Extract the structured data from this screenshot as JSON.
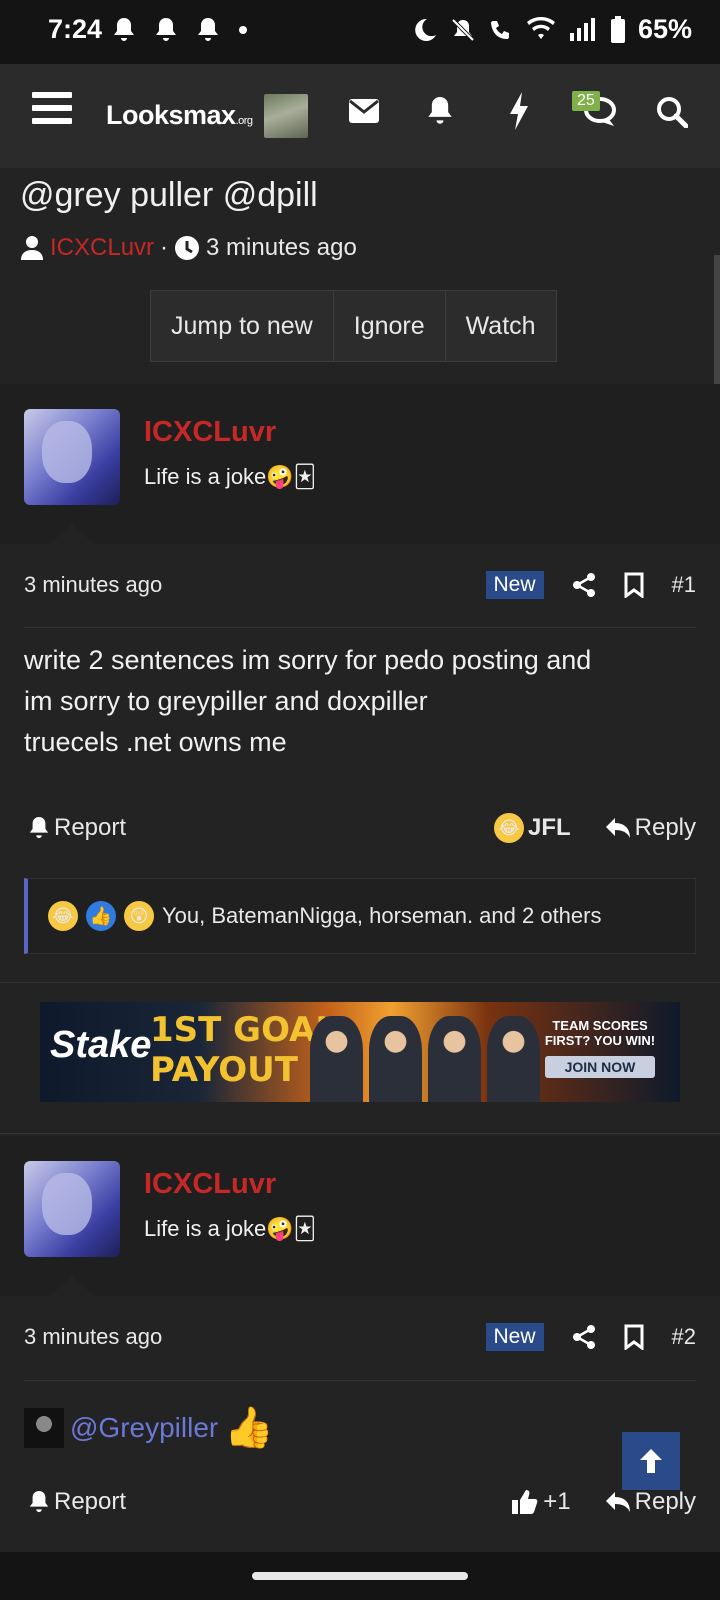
{
  "status_bar": {
    "time": "7:24",
    "battery": "65%",
    "icons": [
      "bell-icon",
      "bell-icon",
      "bell-icon",
      "dot-icon",
      "moon-icon",
      "bell-off-icon",
      "wifi-call-icon",
      "wifi-icon",
      "signal-icon",
      "battery-icon"
    ]
  },
  "navbar": {
    "logo_text": "Looksmax",
    "logo_suffix": ".org",
    "conversations_badge": "25",
    "icons": [
      "menu-icon",
      "mail-icon",
      "bell-icon",
      "lightning-icon",
      "chat-icon",
      "search-icon"
    ]
  },
  "thread": {
    "title": "@grey puller @dpill",
    "author": "ICXCLuvr",
    "separator": "·",
    "time": "3 minutes ago",
    "buttons": [
      "Jump to new",
      "Ignore",
      "Watch"
    ]
  },
  "posts": [
    {
      "username": "ICXCLuvr",
      "user_title": "Life is a joke🤪🃏",
      "time": "3 minutes ago",
      "new_label": "New",
      "number": "#1",
      "body_lines": [
        "write 2 sentences im sorry for pedo posting and",
        "im sorry to greypiller and doxpiller",
        "truecels .net owns me"
      ],
      "report_label": "Report",
      "reaction_label": "JFL",
      "reply_label": "Reply",
      "reactions_text": "You, BatemanNigga, horseman. and 2 others"
    },
    {
      "username": "ICXCLuvr",
      "user_title": "Life is a joke🤪🃏",
      "time": "3 minutes ago",
      "new_label": "New",
      "number": "#2",
      "mention": "@Greypiller",
      "report_label": "Report",
      "like_label": "+1",
      "reply_label": "Reply"
    }
  ],
  "ad": {
    "brand": "Stake",
    "headline_1": "1ST GOAL",
    "headline_2": "PAYOUT",
    "tagline": "TEAM SCORES FIRST? YOU WIN!",
    "cta": "JOIN NOW"
  },
  "colors": {
    "accent_blue": "#2b4a8a",
    "username_red": "#c62828",
    "mention_blue": "#6b78d6",
    "badge_green": "#7fb04a"
  }
}
